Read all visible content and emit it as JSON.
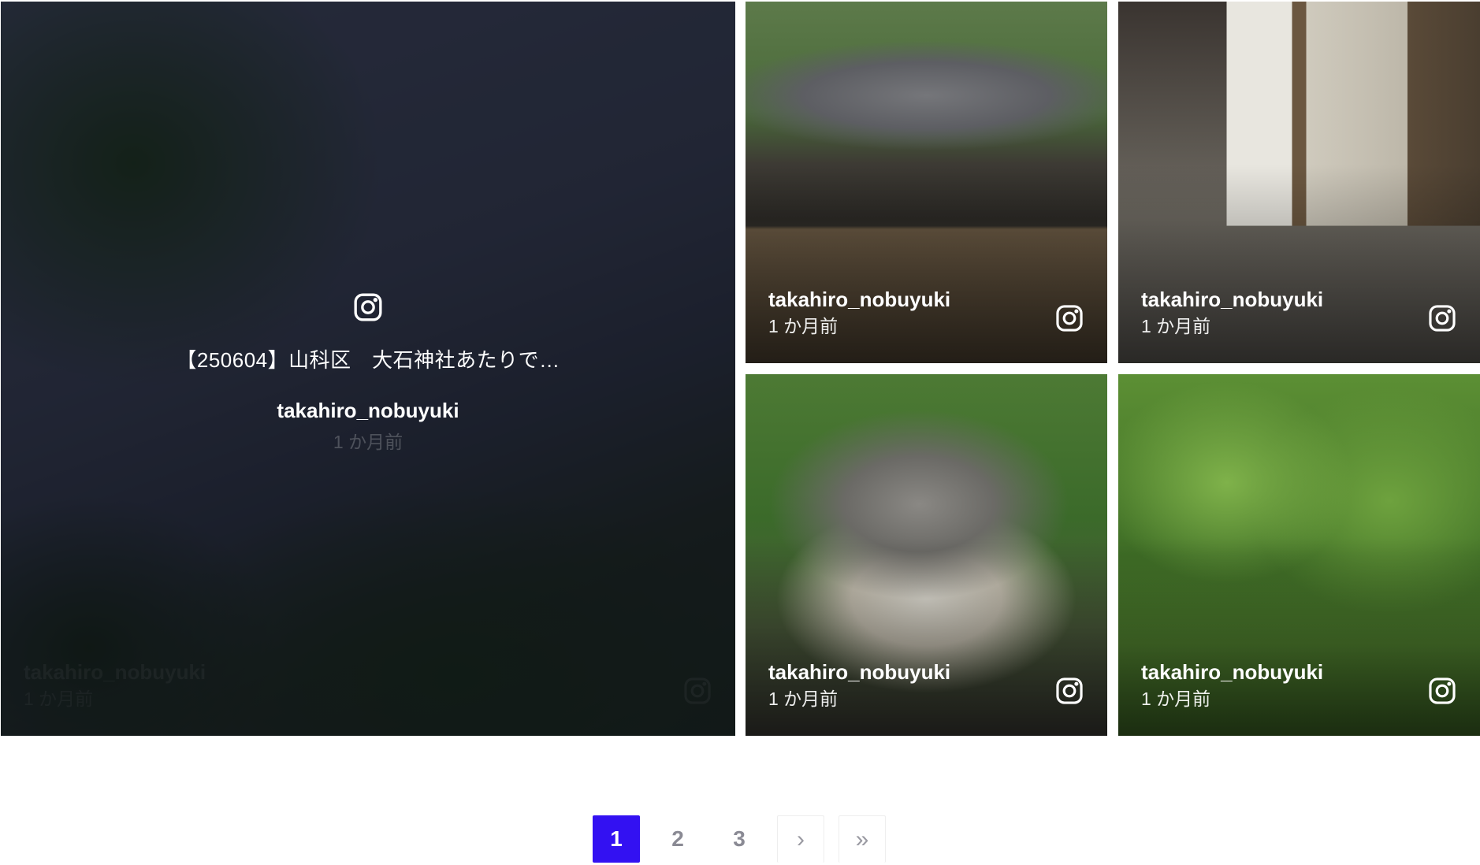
{
  "posts": [
    {
      "username": "takahiro_nobuyuki",
      "time": "1 か月前",
      "caption": "【250604】山科区　大石神社あたりで…",
      "icon": "instagram-icon"
    },
    {
      "username": "takahiro_nobuyuki",
      "time": "1 か月前",
      "icon": "instagram-icon"
    },
    {
      "username": "takahiro_nobuyuki",
      "time": "1 か月前",
      "icon": "instagram-icon"
    },
    {
      "username": "takahiro_nobuyuki",
      "time": "1 か月前",
      "icon": "instagram-icon"
    },
    {
      "username": "takahiro_nobuyuki",
      "time": "1 か月前",
      "icon": "instagram-icon"
    }
  ],
  "pagination": {
    "pages": [
      "1",
      "2",
      "3"
    ],
    "current": "1",
    "next": "›",
    "last": "»",
    "active_color": "#3311f2"
  }
}
